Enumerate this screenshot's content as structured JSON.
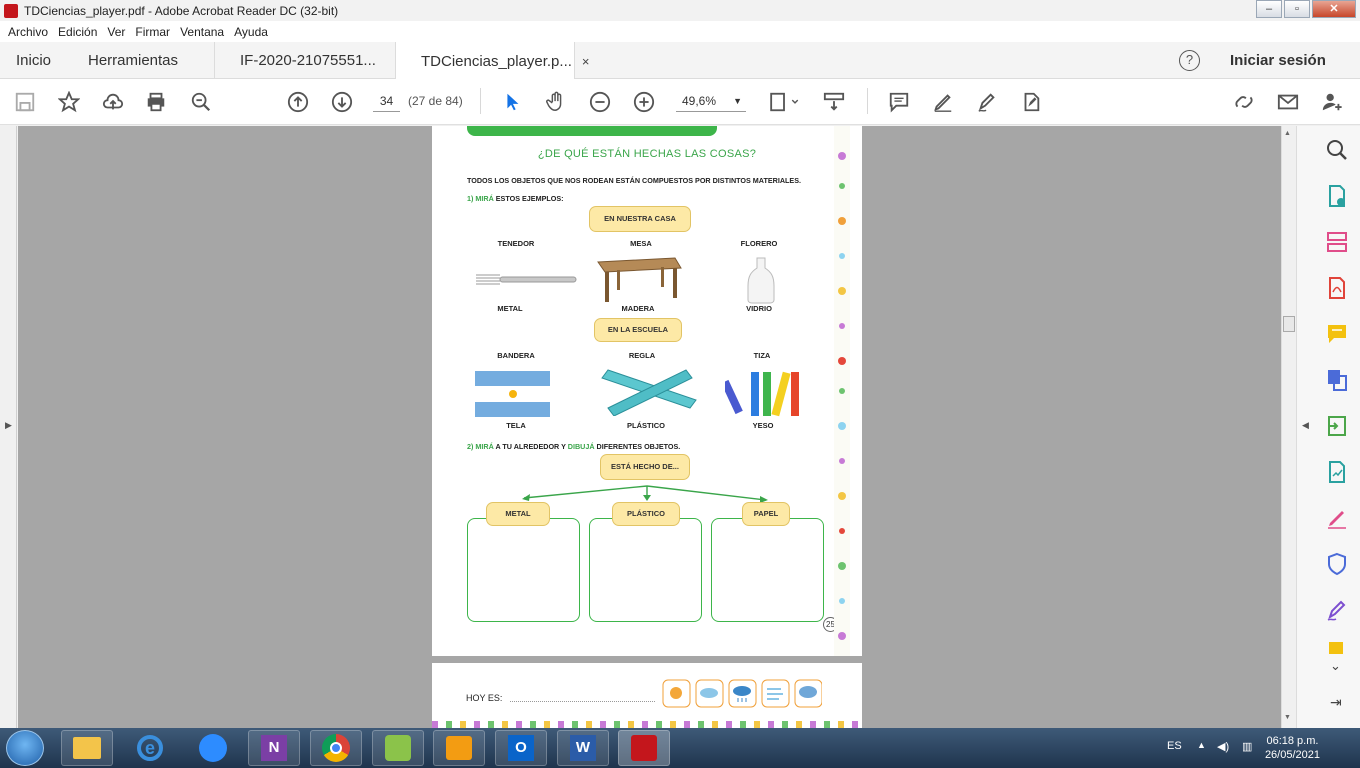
{
  "window": {
    "title": "TDCiencias_player.pdf - Adobe Acrobat Reader DC (32-bit)"
  },
  "menu": [
    "Archivo",
    "Edición",
    "Ver",
    "Firmar",
    "Ventana",
    "Ayuda"
  ],
  "tabs": {
    "home": "Inicio",
    "tools": "Herramientas",
    "doc1": "IF-2020-21075551...",
    "doc2": "TDCiencias_player.p...",
    "close": "×"
  },
  "header": {
    "signin": "Iniciar sesión",
    "help": "?"
  },
  "toolbar": {
    "page_value": "34",
    "page_count": "(27 de 84)",
    "zoom": "49,6%"
  },
  "page": {
    "title": "¿DE QUÉ ESTÁN HECHAS LAS COSAS?",
    "intro": "TODOS LOS OBJETOS QUE NOS RODEAN ESTÁN COMPUESTOS POR DISTINTOS MATERIALES.",
    "q1_num": "1) MIRÁ",
    "q1_text": " ESTOS EJEMPLOS:",
    "section_home": "EN NUESTRA CASA",
    "section_school": "EN LA ESCUELA",
    "home_items": [
      {
        "name": "TENEDOR",
        "material": "METAL"
      },
      {
        "name": "MESA",
        "material": "MADERA"
      },
      {
        "name": "FLORERO",
        "material": "VIDRIO"
      }
    ],
    "school_items": [
      {
        "name": "BANDERA",
        "material": "TELA"
      },
      {
        "name": "REGLA",
        "material": "PLÁSTICO"
      },
      {
        "name": "TIZA",
        "material": "YESO"
      }
    ],
    "q2_num": "2) MIRÁ",
    "q2_mid": " A TU ALREDEDOR Y ",
    "q2_draw": "DIBUJÁ",
    "q2_end": " DIFERENTES OBJETOS.",
    "made_of": "ESTÁ HECHO DE...",
    "boxes": [
      "METAL",
      "PLÁSTICO",
      "PAPEL"
    ],
    "page_number": "25",
    "next_page_label": "HOY ES:"
  },
  "taskbar": {
    "lang": "ES",
    "time": "06:18 p.m.",
    "date": "26/05/2021"
  },
  "colors": {
    "accent_green": "#3db54a",
    "bubble": "#fde9a6",
    "acrobat_red": "#c4161c"
  }
}
